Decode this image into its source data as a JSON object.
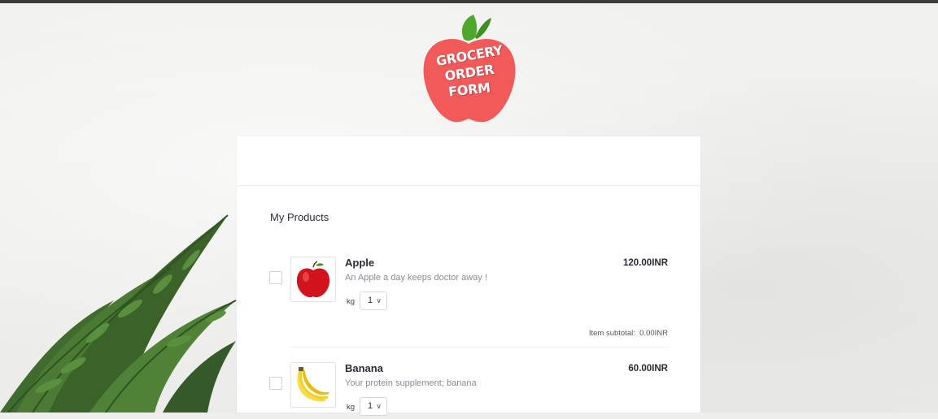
{
  "logo": {
    "lines": [
      "GROCERY",
      "ORDER",
      "FORM"
    ],
    "apple_color": "#f25a5a",
    "leaf_color": "#4ea82e"
  },
  "section_title": "My Products",
  "products": [
    {
      "name": "Apple",
      "description": "An Apple a day keeps doctor away !",
      "price": "120.00INR",
      "unit": "kg",
      "quantity": "1",
      "subtotal_label": "Item subtotal:",
      "subtotal_value": "0.00INR",
      "checked": false,
      "icon": "apple-fruit-icon"
    },
    {
      "name": "Banana",
      "description": "Your protein supplement; banana",
      "price": "60.00INR",
      "unit": "kg",
      "quantity": "1",
      "checked": false,
      "icon": "banana-fruit-icon"
    }
  ]
}
